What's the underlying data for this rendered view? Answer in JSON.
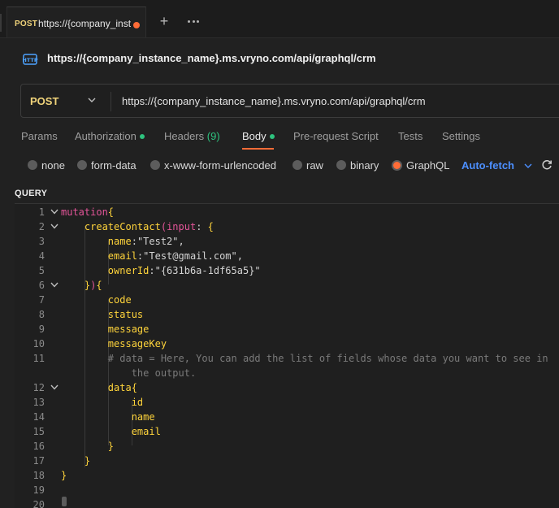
{
  "tab": {
    "method": "POST",
    "title": "https://{company_inst"
  },
  "request": {
    "title": "https://{company_instance_name}.ms.vryno.com/api/graphql/crm",
    "method": "POST",
    "url": "https://{company_instance_name}.ms.vryno.com/api/graphql/crm"
  },
  "request_tabs": [
    {
      "label": "Params"
    },
    {
      "label": "Authorization",
      "dot": true
    },
    {
      "label": "Headers",
      "count": "(9)"
    },
    {
      "label": "Body",
      "dot": true,
      "active": true
    },
    {
      "label": "Pre-request Script"
    },
    {
      "label": "Tests"
    },
    {
      "label": "Settings"
    }
  ],
  "body_types": [
    {
      "label": "none"
    },
    {
      "label": "form-data"
    },
    {
      "label": "x-www-form-urlencoded"
    },
    {
      "label": "raw"
    },
    {
      "label": "binary"
    },
    {
      "label": "GraphQL",
      "selected": true
    }
  ],
  "auto_fetch": "Auto-fetch",
  "query_label": "QUERY",
  "code_lines": [
    {
      "n": "1",
      "fold": true,
      "tokens": [
        [
          "kw",
          "mutation"
        ],
        [
          "fn",
          "{"
        ]
      ]
    },
    {
      "n": "2",
      "fold": true,
      "tokens": [
        [
          "pl",
          "    "
        ],
        [
          "fn",
          "createContact"
        ],
        [
          "par",
          "("
        ],
        [
          "kw",
          "input"
        ],
        [
          "pl",
          ": "
        ],
        [
          "fn",
          "{"
        ]
      ]
    },
    {
      "n": "3",
      "tokens": [
        [
          "pl",
          "        "
        ],
        [
          "fn",
          "name"
        ],
        [
          "pl",
          ":"
        ],
        [
          "str",
          "\"Test2\""
        ],
        [
          "pl",
          ","
        ]
      ]
    },
    {
      "n": "4",
      "tokens": [
        [
          "pl",
          "        "
        ],
        [
          "fn",
          "email"
        ],
        [
          "pl",
          ":"
        ],
        [
          "str",
          "\"Test@gmail.com\""
        ],
        [
          "pl",
          ","
        ]
      ]
    },
    {
      "n": "5",
      "tokens": [
        [
          "pl",
          "        "
        ],
        [
          "fn",
          "ownerId"
        ],
        [
          "pl",
          ":"
        ],
        [
          "str",
          "\"{631b6a-1df65a5}\""
        ]
      ]
    },
    {
      "n": "6",
      "fold": true,
      "tokens": [
        [
          "pl",
          "    "
        ],
        [
          "fn",
          "}"
        ],
        [
          "par",
          ")"
        ],
        [
          "fn",
          "{"
        ]
      ]
    },
    {
      "n": "7",
      "tokens": [
        [
          "pl",
          "        "
        ],
        [
          "fn",
          "code"
        ]
      ]
    },
    {
      "n": "8",
      "tokens": [
        [
          "pl",
          "        "
        ],
        [
          "fn",
          "status"
        ]
      ]
    },
    {
      "n": "9",
      "tokens": [
        [
          "pl",
          "        "
        ],
        [
          "fn",
          "message"
        ]
      ]
    },
    {
      "n": "10",
      "tokens": [
        [
          "pl",
          "        "
        ],
        [
          "fn",
          "messageKey"
        ]
      ]
    },
    {
      "n": "11",
      "tokens": [
        [
          "pl",
          "        "
        ],
        [
          "cm",
          "# data = Here, You can add the list of fields whose data you want to see in"
        ]
      ]
    },
    {
      "n": "",
      "tokens": [
        [
          "pl",
          "            "
        ],
        [
          "cm",
          "the output."
        ]
      ]
    },
    {
      "n": "12",
      "fold": true,
      "tokens": [
        [
          "pl",
          "        "
        ],
        [
          "fn",
          "data{"
        ]
      ]
    },
    {
      "n": "13",
      "tokens": [
        [
          "pl",
          "            "
        ],
        [
          "fn",
          "id"
        ]
      ]
    },
    {
      "n": "14",
      "tokens": [
        [
          "pl",
          "            "
        ],
        [
          "fn",
          "name"
        ]
      ]
    },
    {
      "n": "15",
      "tokens": [
        [
          "pl",
          "            "
        ],
        [
          "fn",
          "email"
        ]
      ]
    },
    {
      "n": "16",
      "tokens": [
        [
          "pl",
          "        "
        ],
        [
          "fn",
          "}"
        ]
      ]
    },
    {
      "n": "17",
      "tokens": [
        [
          "pl",
          "    "
        ],
        [
          "fn",
          "}"
        ]
      ]
    },
    {
      "n": "18",
      "tokens": [
        [
          "fn",
          "}"
        ]
      ]
    },
    {
      "n": "19",
      "tokens": []
    },
    {
      "n": "20",
      "tokens": []
    }
  ]
}
